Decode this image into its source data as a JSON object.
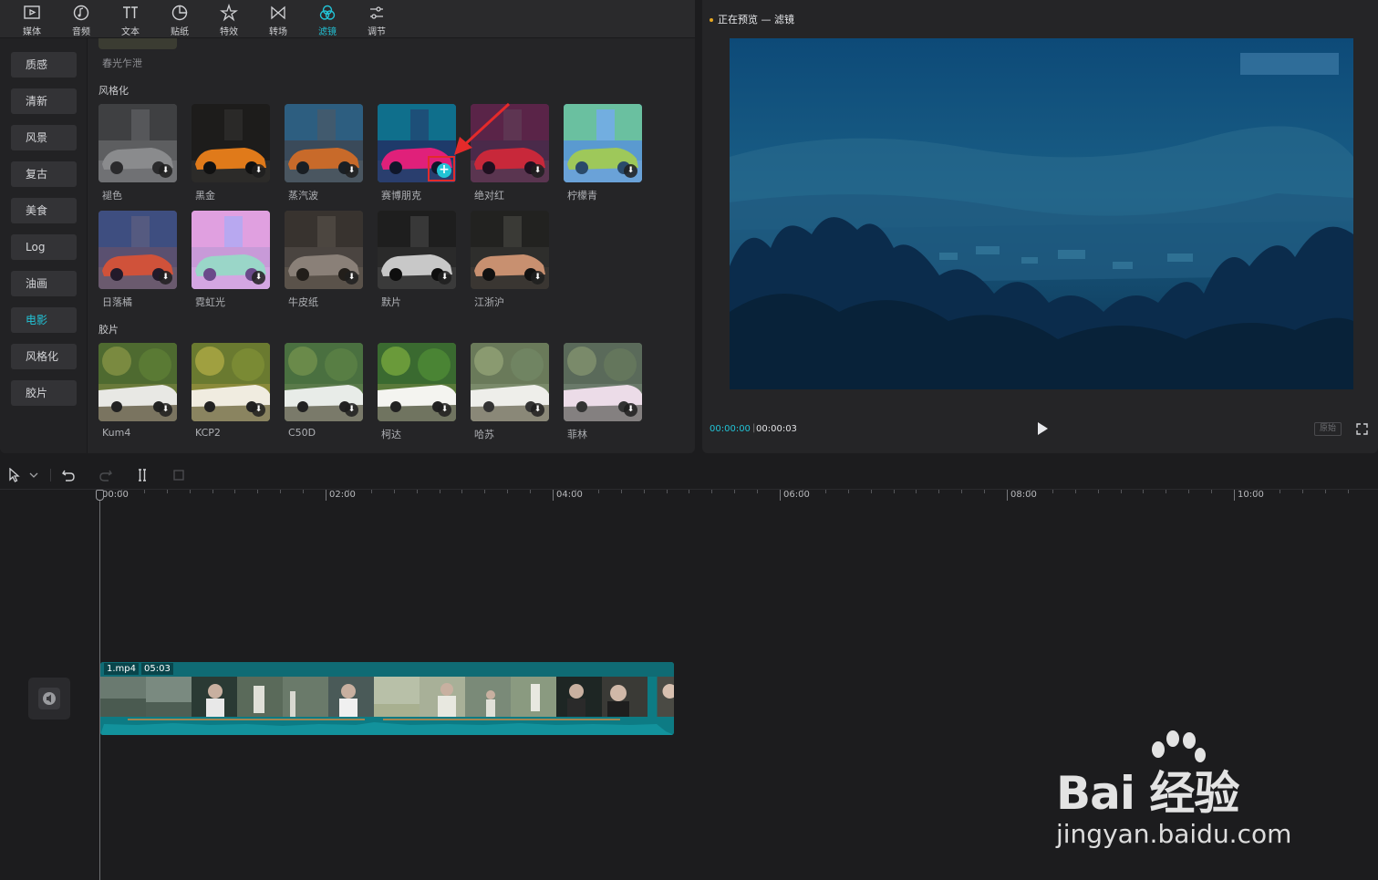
{
  "toolbar": {
    "tabs": [
      {
        "label": "媒体",
        "icon": "media-icon"
      },
      {
        "label": "音频",
        "icon": "audio-icon"
      },
      {
        "label": "文本",
        "icon": "text-icon"
      },
      {
        "label": "贴纸",
        "icon": "sticker-icon"
      },
      {
        "label": "特效",
        "icon": "effects-icon"
      },
      {
        "label": "转场",
        "icon": "transition-icon"
      },
      {
        "label": "滤镜",
        "icon": "filter-icon",
        "active": true
      },
      {
        "label": "调节",
        "icon": "adjust-icon"
      }
    ]
  },
  "categories": [
    "质感",
    "清新",
    "风景",
    "复古",
    "美食",
    "Log",
    "油画",
    "电影",
    "风格化",
    "胶片"
  ],
  "active_category": "电影",
  "filters": {
    "prev_item_label": "春光乍泄",
    "section_stylized": "风格化",
    "stylized": [
      "褪色",
      "黑金",
      "蒸汽波",
      "赛博朋克",
      "绝对红",
      "柠檬青",
      "日落橘",
      "霓虹光",
      "牛皮纸",
      "默片",
      "江浙沪"
    ],
    "selected": "赛博朋克",
    "section_film": "胶片",
    "film": [
      "Kum4",
      "KCP2",
      "C50D",
      "柯达",
      "哈苏",
      "菲林"
    ]
  },
  "preview": {
    "title": "正在预览 — 滤镜",
    "current_time": "00:00:00",
    "total_time": "00:00:03",
    "ratio_label": "原始",
    "accent_color": "#22c3d6"
  },
  "timeline": {
    "ruler": [
      "00:00",
      "02:00",
      "04:00",
      "06:00",
      "08:00",
      "10:00"
    ],
    "clip": {
      "name": "1.mp4",
      "duration": "05:03"
    }
  },
  "watermark": {
    "brand": "Bai 经验",
    "url": "jingyan.baidu.com"
  }
}
